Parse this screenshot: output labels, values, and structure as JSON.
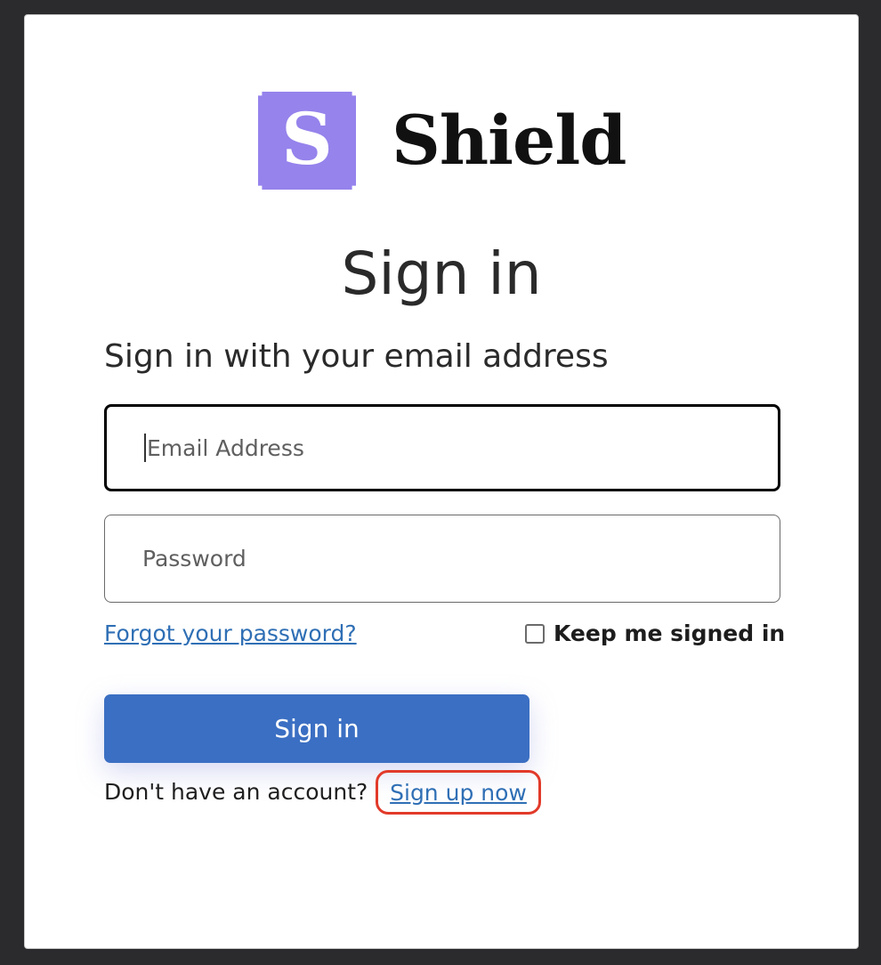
{
  "brand": {
    "logo_letter": "S",
    "name": "Shield",
    "accent_color": "#9683ec"
  },
  "form": {
    "title": "Sign in",
    "subtitle": "Sign in with your email address",
    "email_placeholder": "Email Address",
    "password_placeholder": "Password",
    "forgot_label": "Forgot your password?",
    "keep_signed_in_label": "Keep me signed in",
    "keep_signed_in_checked": false,
    "submit_label": "Sign in",
    "no_account_text": "Don't have an account?",
    "signup_label": "Sign up now"
  },
  "colors": {
    "button": "#3b6fc3",
    "link": "#2f6fb5",
    "highlight_outline": "#e23a2a"
  }
}
